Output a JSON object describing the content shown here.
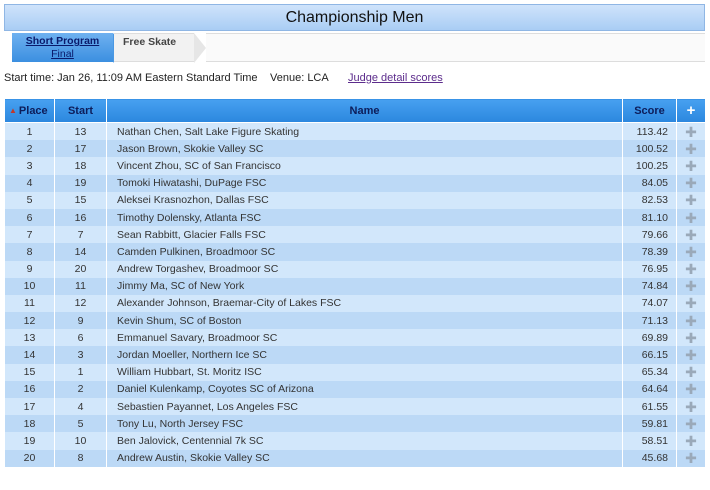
{
  "title": "Championship Men",
  "tabs": {
    "active": {
      "label": "Short Program",
      "sub": "Final"
    },
    "next": {
      "label": "Free Skate"
    }
  },
  "info": {
    "start_time": "Start time: Jan 26, 11:09 AM Eastern Standard Time",
    "venue": "Venue: LCA",
    "judge_link": "Judge detail scores"
  },
  "table": {
    "headers": {
      "place": "Place",
      "start": "Start",
      "name": "Name",
      "score": "Score",
      "add": "+"
    },
    "rows": [
      {
        "place": "1",
        "start": "13",
        "name": "Nathan Chen, Salt Lake Figure Skating",
        "score": "113.42"
      },
      {
        "place": "2",
        "start": "17",
        "name": "Jason Brown, Skokie Valley SC",
        "score": "100.52"
      },
      {
        "place": "3",
        "start": "18",
        "name": "Vincent Zhou, SC of San Francisco",
        "score": "100.25"
      },
      {
        "place": "4",
        "start": "19",
        "name": "Tomoki Hiwatashi, DuPage FSC",
        "score": "84.05"
      },
      {
        "place": "5",
        "start": "15",
        "name": "Aleksei Krasnozhon, Dallas FSC",
        "score": "82.53"
      },
      {
        "place": "6",
        "start": "16",
        "name": "Timothy Dolensky, Atlanta FSC",
        "score": "81.10"
      },
      {
        "place": "7",
        "start": "7",
        "name": "Sean Rabbitt, Glacier Falls FSC",
        "score": "79.66"
      },
      {
        "place": "8",
        "start": "14",
        "name": "Camden Pulkinen, Broadmoor SC",
        "score": "78.39"
      },
      {
        "place": "9",
        "start": "20",
        "name": "Andrew Torgashev, Broadmoor SC",
        "score": "76.95"
      },
      {
        "place": "10",
        "start": "11",
        "name": "Jimmy Ma, SC of New York",
        "score": "74.84"
      },
      {
        "place": "11",
        "start": "12",
        "name": "Alexander Johnson, Braemar-City of Lakes FSC",
        "score": "74.07"
      },
      {
        "place": "12",
        "start": "9",
        "name": "Kevin Shum, SC of Boston",
        "score": "71.13"
      },
      {
        "place": "13",
        "start": "6",
        "name": "Emmanuel Savary, Broadmoor SC",
        "score": "69.89"
      },
      {
        "place": "14",
        "start": "3",
        "name": "Jordan Moeller, Northern Ice SC",
        "score": "66.15"
      },
      {
        "place": "15",
        "start": "1",
        "name": "William Hubbart, St. Moritz ISC",
        "score": "65.34"
      },
      {
        "place": "16",
        "start": "2",
        "name": "Daniel Kulenkamp, Coyotes SC of Arizona",
        "score": "64.64"
      },
      {
        "place": "17",
        "start": "4",
        "name": "Sebastien Payannet, Los Angeles FSC",
        "score": "61.55"
      },
      {
        "place": "18",
        "start": "5",
        "name": "Tony Lu, North Jersey FSC",
        "score": "59.81"
      },
      {
        "place": "19",
        "start": "10",
        "name": "Ben Jalovick, Centennial 7k SC",
        "score": "58.51"
      },
      {
        "place": "20",
        "start": "8",
        "name": "Andrew Austin, Skokie Valley SC",
        "score": "45.68"
      }
    ]
  },
  "icons": {
    "sort": "sort-up-icon",
    "expand": "plus-icon"
  }
}
